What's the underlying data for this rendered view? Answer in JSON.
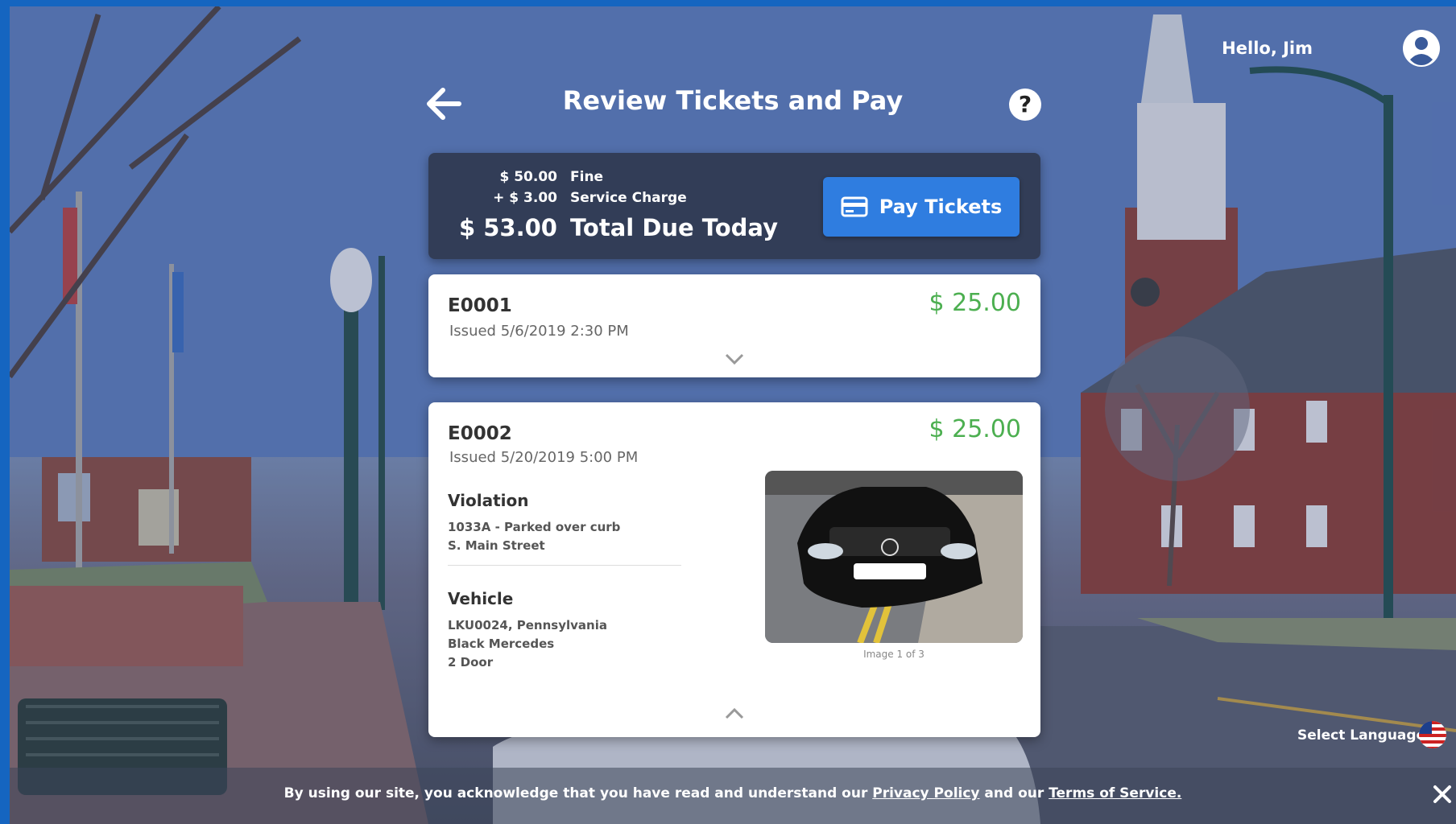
{
  "header": {
    "title": "Review Tickets and Pay",
    "greeting": "Hello, Jim",
    "help_symbol": "?"
  },
  "summary": {
    "fine_amount": "$ 50.00",
    "fine_label": "Fine",
    "service_amount": "+ $ 3.00",
    "service_label": "Service Charge",
    "total_amount": "$ 53.00",
    "total_label": "Total Due Today",
    "pay_button_label": "Pay Tickets"
  },
  "tickets": [
    {
      "id": "E0001",
      "issued": "Issued 5/6/2019 2:30 PM",
      "amount": "$ 25.00",
      "expanded": false
    },
    {
      "id": "E0002",
      "issued": "Issued 5/20/2019 5:00 PM",
      "amount": "$ 25.00",
      "expanded": true,
      "violation_heading": "Violation",
      "violation_code": "1033A - Parked over curb",
      "violation_location": "S. Main Street",
      "vehicle_heading": "Vehicle",
      "vehicle_plate": "LKU0024, Pennsylvania",
      "vehicle_desc": "Black Mercedes",
      "vehicle_doors": "2 Door",
      "image_caption": "Image 1 of 3"
    }
  ],
  "footer": {
    "language_label": "Select Language",
    "cookie_prefix": "By using our site, you acknowledge that you have read and understand our ",
    "privacy_link": "Privacy Policy",
    "cookie_mid": " and our ",
    "terms_link": "Terms of Service.",
    "close_icon": "close-icon"
  },
  "colors": {
    "accent": "#2f7de0",
    "price": "#4caf50",
    "frame": "#1565c0"
  }
}
